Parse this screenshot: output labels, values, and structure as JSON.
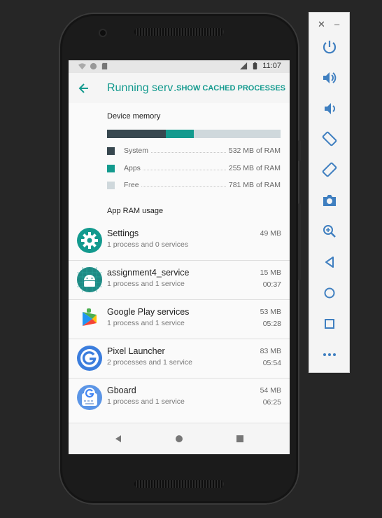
{
  "status_bar": {
    "time": "11:07"
  },
  "app_bar": {
    "title": "Running serv…",
    "action": "SHOW CACHED PROCESSES"
  },
  "device_memory": {
    "heading": "Device memory",
    "bar_fractions": {
      "system": 0.34,
      "apps": 0.16,
      "free": 0.5
    },
    "rows": [
      {
        "label": "System",
        "value": "532 MB of RAM",
        "color": "#37474f"
      },
      {
        "label": "Apps",
        "value": "255 MB of RAM",
        "color": "#139a8e"
      },
      {
        "label": "Free",
        "value": "781 MB of RAM",
        "color": "#cfd8dc"
      }
    ]
  },
  "app_ram": {
    "heading": "App RAM usage",
    "apps": [
      {
        "name": "Settings",
        "detail": "1 process and 0 services",
        "size": "49 MB",
        "time": "",
        "icon": "settings-gear-icon"
      },
      {
        "name": "assignment4_service",
        "detail": "1 process and 1 service",
        "size": "15 MB",
        "time": "00:37",
        "icon": "android-robot-icon"
      },
      {
        "name": "Google Play services",
        "detail": "1 process and 1 service",
        "size": "53 MB",
        "time": "05:28",
        "icon": "play-services-puzzle-icon"
      },
      {
        "name": "Pixel Launcher",
        "detail": "2 processes and 1 service",
        "size": "83 MB",
        "time": "05:54",
        "icon": "google-g-icon"
      },
      {
        "name": "Gboard",
        "detail": "1 process and 1 service",
        "size": "54 MB",
        "time": "06:25",
        "icon": "gboard-icon"
      }
    ]
  },
  "colors": {
    "accent": "#139a8e",
    "toolbar_icon": "#3f7fc0"
  },
  "emulator_toolbar": {
    "close": "✕",
    "minimize": "–",
    "buttons": [
      "power-icon",
      "volume-up-icon",
      "volume-down-icon",
      "rotate-left-icon",
      "rotate-right-icon",
      "screenshot-icon",
      "zoom-icon",
      "back-icon",
      "home-icon",
      "overview-icon",
      "more-icon"
    ]
  }
}
